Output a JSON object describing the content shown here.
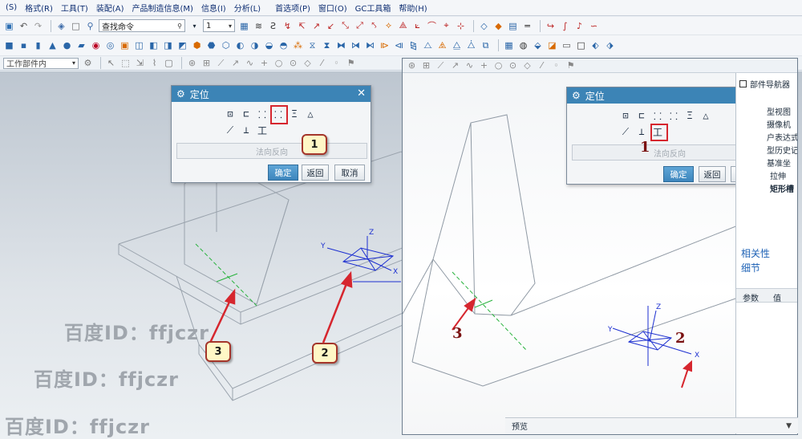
{
  "menubar": {
    "items": [
      "(S)",
      "格式(R)",
      "工具(T)",
      "装配(A)",
      "产品制造信息(M)",
      "信息(I)",
      "分析(L)",
      "首选项(P)",
      "窗口(O)",
      "GC工具箱",
      "帮助(H)"
    ]
  },
  "toolbar": {
    "search_command": "查找命令",
    "layer_value": "1",
    "filter_value": "工作部件内"
  },
  "dialog": {
    "title": "定位",
    "flip_label": "法向反向",
    "ok_label": "确定",
    "back_label": "返回",
    "cancel_label": "取消",
    "icons_row1": [
      "⊡",
      "⊏",
      "⸬",
      "⸬",
      "Ξ",
      "△"
    ],
    "icons_row2": [
      "⟋",
      "⊥",
      "工"
    ]
  },
  "callouts": {
    "left": [
      "1",
      "2",
      "3"
    ],
    "right": [
      "1",
      "2",
      "3"
    ]
  },
  "axes": {
    "x": "X",
    "y": "Y",
    "z": "Z"
  },
  "watermark": {
    "text": "百度ID：ffjczr"
  },
  "nav_panel": {
    "header": "部件导航器",
    "items": [
      "型视图",
      "摄像机",
      "户表达式",
      "型历史记",
      "基准坐",
      "拉伸",
      "矩形槽"
    ],
    "relevance": "相关性",
    "details": "细节",
    "col_param": "参数",
    "col_value": "值"
  },
  "preview": {
    "label": "预览"
  },
  "colors": {
    "title_bar": "#3c84b6",
    "highlight": "#d6262e",
    "arrow": "#d6262e",
    "csys": "#1c2fd0",
    "centerline": "#27b23c"
  }
}
